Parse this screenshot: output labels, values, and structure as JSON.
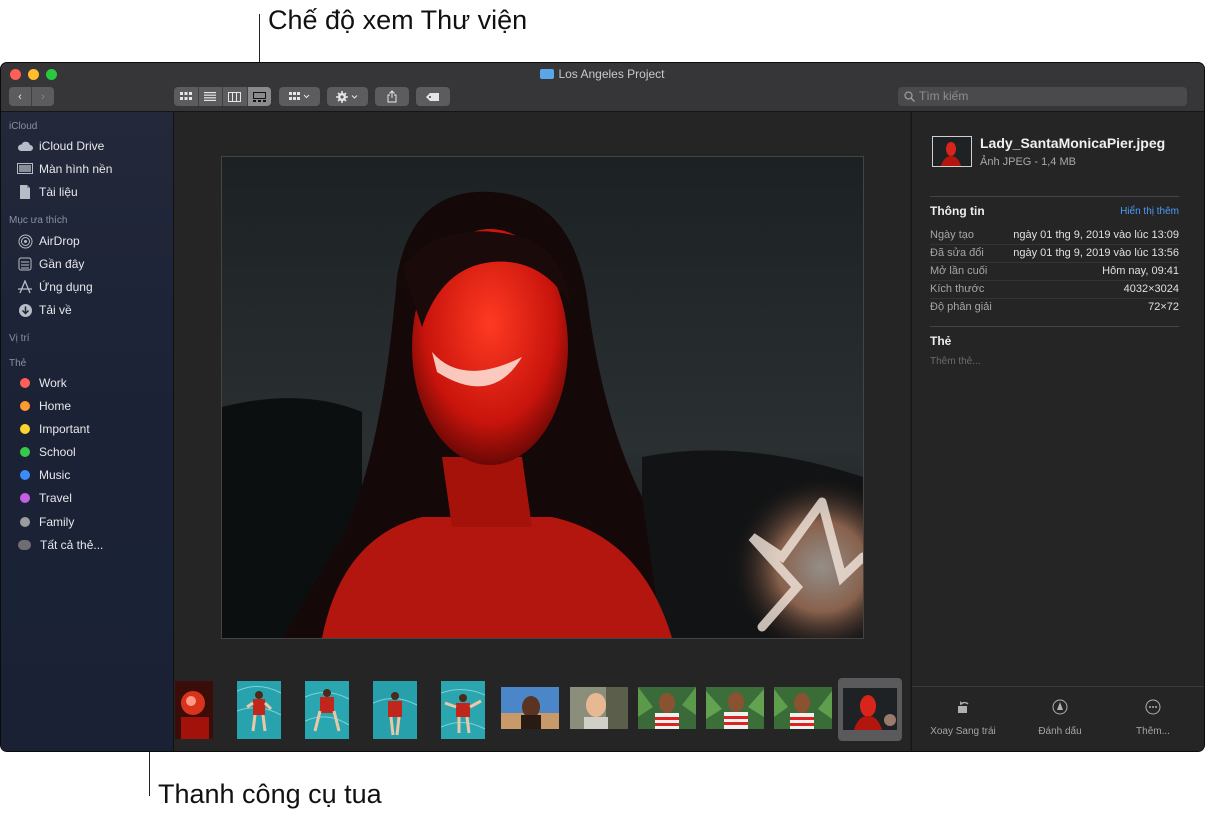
{
  "callouts": {
    "top": "Chế độ xem Thư viện",
    "bottom": "Thanh công cụ tua"
  },
  "window": {
    "title": "Los Angeles Project",
    "traffic_colors": [
      "#fe5f57",
      "#febc2e",
      "#28c840"
    ]
  },
  "toolbar": {
    "back_icon": "chevron-left-icon",
    "forward_icon": "chevron-right-icon",
    "views": [
      "icon-view",
      "list-view",
      "column-view",
      "gallery-view"
    ],
    "selected_view": "gallery-view",
    "group_icon": "group-icon",
    "action_icon": "gear-icon",
    "share_icon": "share-icon",
    "tag_icon": "tag-icon",
    "search_placeholder": "Tìm kiếm"
  },
  "sidebar": {
    "sections": {
      "icloud": "iCloud",
      "favorites": "Mục ưa thích",
      "locations": "Vị trí",
      "tags": "Thẻ"
    },
    "icloud_items": [
      {
        "label": "iCloud Drive",
        "icon": "cloud-icon"
      },
      {
        "label": "Màn hình nền",
        "icon": "desktop-icon"
      },
      {
        "label": "Tài liệu",
        "icon": "document-icon"
      }
    ],
    "favorite_items": [
      {
        "label": "AirDrop",
        "icon": "airdrop-icon"
      },
      {
        "label": "Gần đây",
        "icon": "clock-icon"
      },
      {
        "label": "Ứng dụng",
        "icon": "applications-icon"
      },
      {
        "label": "Tải về",
        "icon": "download-icon"
      }
    ],
    "tags": [
      {
        "label": "Work",
        "color": "#fe5f57"
      },
      {
        "label": "Home",
        "color": "#fd9a30"
      },
      {
        "label": "Important",
        "color": "#fdd42f"
      },
      {
        "label": "School",
        "color": "#36c94a"
      },
      {
        "label": "Music",
        "color": "#3a8cf6"
      },
      {
        "label": "Travel",
        "color": "#c65ee4"
      },
      {
        "label": "Family",
        "color": "#9c9ca0"
      },
      {
        "label": "Tất cả thẻ...",
        "color": "#6e6e72"
      }
    ]
  },
  "info": {
    "filename": "Lady_SantaMonicaPier.jpeg",
    "subtitle": "Ảnh JPEG - 1,4 MB",
    "section_info": "Thông tin",
    "show_more": "Hiển thị thêm",
    "rows": [
      {
        "key": "Ngày tạo",
        "value": "ngày 01 thg 9, 2019 vào lúc 13:09"
      },
      {
        "key": "Đã sửa đổi",
        "value": "ngày 01 thg 9, 2019 vào lúc 13:56"
      },
      {
        "key": "Mở lần cuối",
        "value": "Hôm nay, 09:41"
      },
      {
        "key": "Kích thước",
        "value": "4032×3024"
      },
      {
        "key": "Độ phân giải",
        "value": "72×72"
      }
    ],
    "section_tags": "Thẻ",
    "tags_placeholder": "Thêm thẻ...",
    "actions": [
      {
        "label": "Xoay Sang trái",
        "icon": "rotate-left-icon"
      },
      {
        "label": "Đánh dấu",
        "icon": "markup-icon"
      },
      {
        "label": "Thêm...",
        "icon": "more-icon"
      }
    ]
  },
  "filmstrip": {
    "thumbnails": [
      "portrait-red",
      "pool-1",
      "pool-2",
      "pool-3",
      "pool-4",
      "beach-portrait",
      "smiling-woman",
      "man-stripes-1",
      "man-stripes-2",
      "man-stripes-3",
      "lady-santa-monica-pier"
    ],
    "selected": "lady-santa-monica-pier"
  }
}
